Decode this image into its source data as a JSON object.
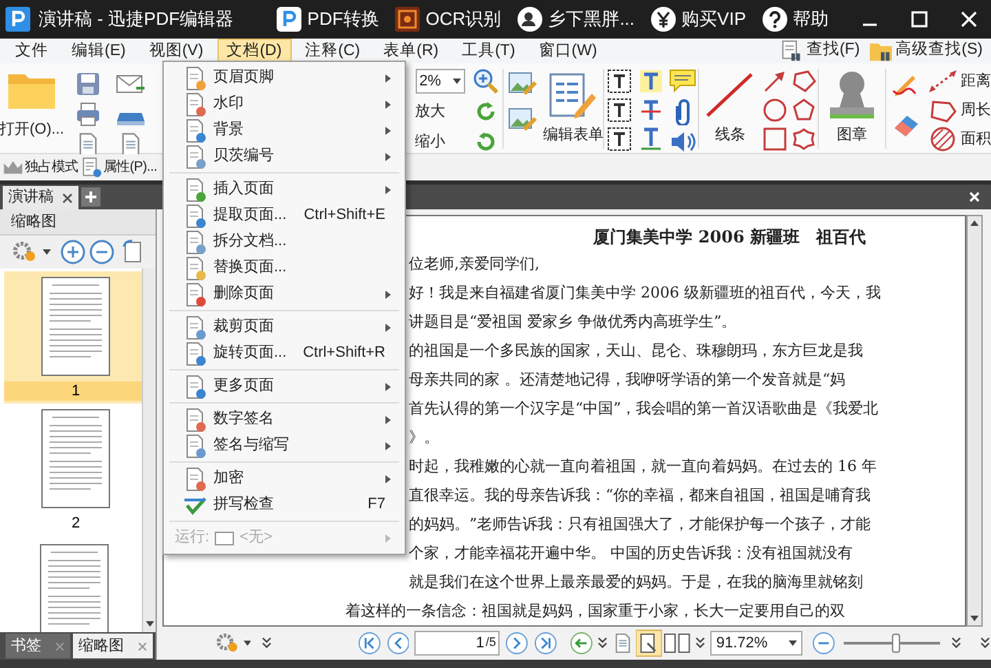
{
  "title_bar": {
    "app_title": "演讲稿 - 迅捷PDF编辑器",
    "actions": [
      {
        "label": "PDF转换",
        "kind": "pdf"
      },
      {
        "label": "OCR识别",
        "kind": "ocr"
      },
      {
        "label": "乡下黑胖...",
        "kind": "user"
      },
      {
        "label": "购买VIP",
        "kind": "vip"
      },
      {
        "label": "帮助",
        "kind": "help"
      }
    ]
  },
  "menu_bar": {
    "items": [
      {
        "label": "文件",
        "selected": false
      },
      {
        "label": "编辑(E)",
        "selected": false
      },
      {
        "label": "视图(V)",
        "selected": false
      },
      {
        "label": "文档(D)",
        "selected": true
      },
      {
        "label": "注释(C)",
        "selected": false
      },
      {
        "label": "表单(R)",
        "selected": false
      },
      {
        "label": "工具(T)",
        "selected": false
      },
      {
        "label": "窗口(W)",
        "selected": false
      }
    ],
    "search_links": [
      {
        "label": "查找(F)",
        "kind": "find"
      },
      {
        "label": "高级查找(S)",
        "kind": "advanced"
      }
    ]
  },
  "ribbon": {
    "open_label": "打开(O)...",
    "zoom_value": "2%",
    "zoom_in_label": "放大",
    "zoom_out_label": "缩小",
    "form_label": "编辑表单",
    "line_label": "线条",
    "stamp_label": "图章",
    "measure_labels": [
      "距离",
      "周长",
      "面积"
    ]
  },
  "quick_bar": {
    "items": [
      {
        "label": "独占模式",
        "kind": "exclusive"
      },
      {
        "label": "属性(P)...",
        "kind": "properties"
      }
    ]
  },
  "doc_tabs": [
    {
      "label": "演讲稿",
      "selected": true
    }
  ],
  "side_panel": {
    "title": "缩略图",
    "pages": [
      {
        "label": "1",
        "selected": true
      },
      {
        "label": "2",
        "selected": false
      }
    ]
  },
  "panel_tabs": [
    {
      "label": "书签",
      "selected": false
    },
    {
      "label": "缩略图",
      "selected": true
    }
  ],
  "document": {
    "heading": "厦门集美中学 2006 新疆班　祖百代",
    "lines": [
      {
        "text": "位老师,亲爱同学们,",
        "kind": "under_menu"
      },
      {
        "text": "好！我是来自福建省厦门集美中学 2006 级新疆班的祖百代，今天，我",
        "kind": "under_menu"
      },
      {
        "text": "讲题目是“爱祖国  爱家乡  争做优秀内高班学生”。",
        "kind": "under_menu"
      },
      {
        "text": "的祖国是一个多民族的国家，天山、昆仑、珠穆朗玛，东方巨龙是我",
        "kind": "under_menu"
      },
      {
        "text": "母亲共同的家  。还清楚地记得，我咿呀学语的第一个发音就是“妈",
        "kind": "under_menu"
      },
      {
        "text": "首先认得的第一个汉字是“中国”，我会唱的第一首汉语歌曲是《我爱北",
        "kind": "under_menu"
      },
      {
        "text": "》。",
        "kind": "under_menu"
      },
      {
        "text": "时起，我稚嫩的心就一直向着祖国，就一直向着妈妈。在过去的 16 年",
        "kind": "under_menu"
      },
      {
        "text": "直很幸运。我的母亲告诉我：“你的幸福，都来自祖国，祖国是哺育我",
        "kind": "under_menu"
      },
      {
        "text": "的妈妈。”老师告诉我：只有祖国强大了，才能保护每一个孩子，才能",
        "kind": "under_menu"
      },
      {
        "text": "个家，才能幸福花开遍中华。   中国的历史告诉我：没有祖国就没有",
        "kind": "under_menu"
      },
      {
        "text": "就是我们在这个世界上最亲最爱的妈妈。于是，在我的脑海里就铭刻",
        "kind": "under_menu"
      },
      {
        "text": "着这样的一条信念：祖国就是妈妈，国家重于小家，长大一定要用自己的双",
        "kind": "clear"
      }
    ]
  },
  "doc_menu": {
    "groups": [
      [
        {
          "label": "页眉页脚",
          "submenu": true
        },
        {
          "label": "水印",
          "submenu": true
        },
        {
          "label": "背景",
          "submenu": true
        },
        {
          "label": "贝茨编号",
          "submenu": true
        }
      ],
      [
        {
          "label": "插入页面",
          "submenu": true
        },
        {
          "label": "提取页面...",
          "shortcut": "Ctrl+Shift+E",
          "submenu": false
        },
        {
          "label": "拆分文档...",
          "submenu": false
        },
        {
          "label": "替换页面...",
          "submenu": false
        },
        {
          "label": "删除页面",
          "submenu": true
        }
      ],
      [
        {
          "label": "裁剪页面",
          "submenu": true
        },
        {
          "label": "旋转页面...",
          "shortcut": "Ctrl+Shift+R",
          "submenu": false
        }
      ],
      [
        {
          "label": "更多页面",
          "submenu": true
        }
      ],
      [
        {
          "label": "数字签名",
          "submenu": true
        },
        {
          "label": "签名与缩写",
          "submenu": true
        }
      ],
      [
        {
          "label": "加密",
          "submenu": true
        },
        {
          "label": "拼写检查",
          "shortcut": "F7",
          "submenu": false
        }
      ]
    ],
    "run_row": {
      "label": "运行:",
      "value": "<无>",
      "disabled": true,
      "submenu": true
    }
  },
  "status_bar": {
    "page": "1",
    "page_count": "/5",
    "zoom": "91.72%",
    "zoom_slider": {
      "level": 0.55
    }
  }
}
